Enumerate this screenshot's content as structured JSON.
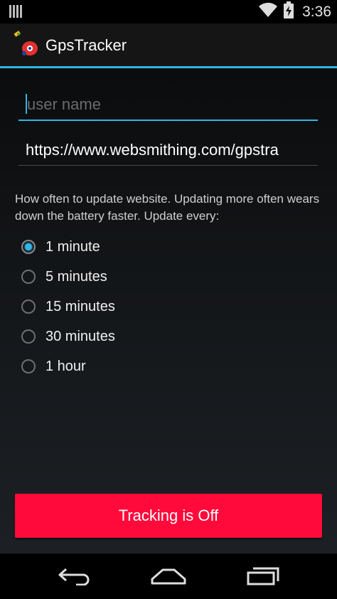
{
  "status_bar": {
    "time": "3:36",
    "icons": [
      "notification-bars-icon",
      "wifi-icon",
      "battery-charging-icon"
    ]
  },
  "action_bar": {
    "title": "GpsTracker",
    "accent_color": "#33b5e5"
  },
  "form": {
    "username": {
      "value": "",
      "placeholder": "user name"
    },
    "website": {
      "value": "https://www.websmithing.com/gpstra",
      "placeholder": ""
    },
    "help_text": "How often to update website. Updating more often wears down the battery faster. Update every:",
    "intervals": [
      {
        "label": "1 minute",
        "checked": true
      },
      {
        "label": "5 minutes",
        "checked": false
      },
      {
        "label": "15 minutes",
        "checked": false
      },
      {
        "label": "30 minutes",
        "checked": false
      },
      {
        "label": "1 hour",
        "checked": false
      }
    ],
    "tracking_button": {
      "label": "Tracking is Off",
      "color": "#ff0a3a"
    }
  },
  "nav_bar": {
    "icons": [
      "back-icon",
      "home-icon",
      "recent-apps-icon"
    ]
  }
}
